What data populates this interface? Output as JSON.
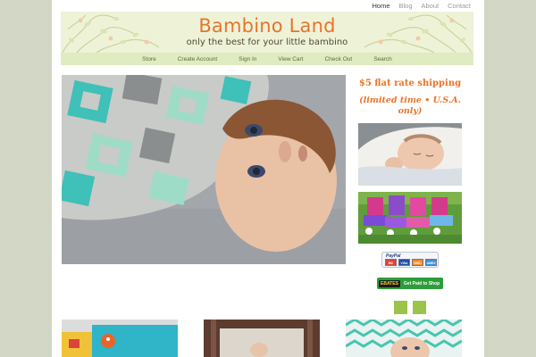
{
  "topnav": {
    "items": [
      {
        "label": "Home",
        "active": true
      },
      {
        "label": "Blog",
        "active": false
      },
      {
        "label": "About",
        "active": false
      },
      {
        "label": "Contact",
        "active": false
      }
    ]
  },
  "header": {
    "title": "Bambino Land",
    "tagline": "only the best for your little bambino"
  },
  "mainnav": {
    "items": [
      "Store",
      "Create Account",
      "Sign In",
      "View Cart",
      "Check Out",
      "Search"
    ]
  },
  "sidebar": {
    "promo_line1": "$5 flat rate shipping",
    "promo_line2a": "(limited time • U.S.A.",
    "promo_line2b": "only)",
    "paypal": {
      "label": "PayPal",
      "cards": [
        "MC",
        "VISA",
        "DISC",
        "AMEX"
      ]
    },
    "ebates": {
      "logo": "EBATES",
      "text": "Get Paid to Shop"
    }
  },
  "colors": {
    "accent": "#e8742a",
    "background": "#d3d8c6",
    "header_bg": "#eef3d8",
    "nav_bg": "#dfebc0",
    "slider_square": "#9cc34a",
    "ebates_green": "#2d9c3a"
  }
}
